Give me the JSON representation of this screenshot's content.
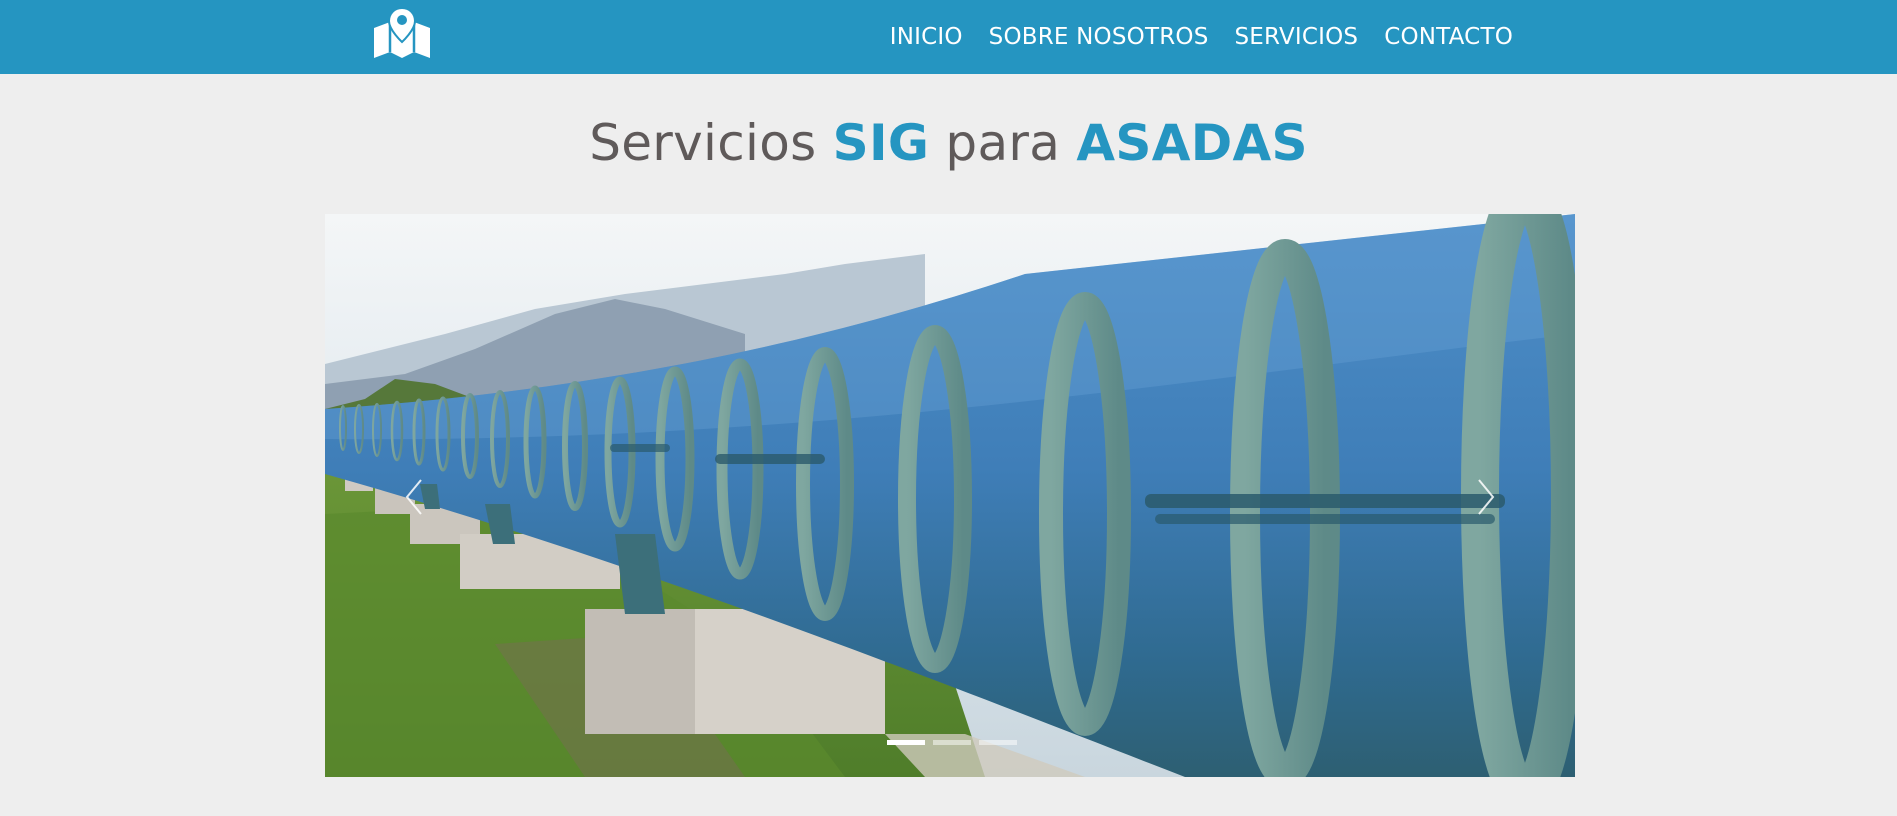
{
  "header": {
    "logo_icon": "map-pin-icon",
    "nav": [
      {
        "label": "INICIO"
      },
      {
        "label": "SOBRE NOSOTROS"
      },
      {
        "label": "SERVICIOS"
      },
      {
        "label": "CONTACTO"
      }
    ]
  },
  "hero": {
    "title_part1": "Servicios ",
    "title_highlight1": "SIG",
    "title_part2": " para ",
    "title_highlight2": "ASADAS"
  },
  "carousel": {
    "image_description": "pipeline-photo",
    "prev_icon": "chevron-left-icon",
    "next_icon": "chevron-right-icon",
    "slide_count": 3,
    "active_slide": 1
  },
  "colors": {
    "brand": "#2595c1",
    "title_text": "#5f5a5a",
    "background": "#eeeeee"
  }
}
